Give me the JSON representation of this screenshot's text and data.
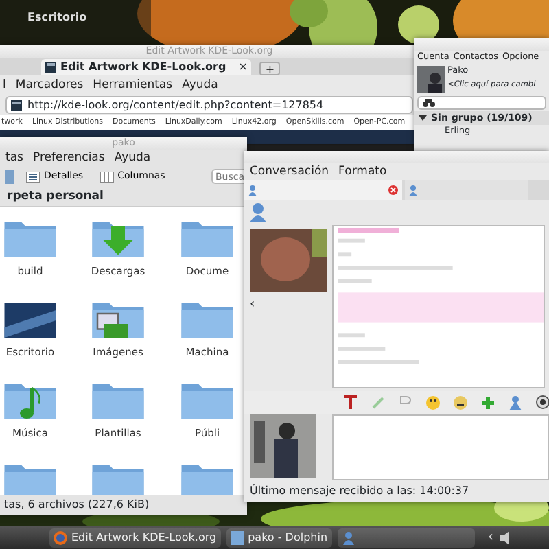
{
  "desktop": {
    "widget_title": "Escritorio"
  },
  "browser": {
    "title": "Edit Artwork KDE-Look.org",
    "tabs": [
      {
        "label": "Edit Artwork KDE-Look.org",
        "close": "×",
        "selected": true
      }
    ],
    "new_tab": "+",
    "menu": [
      "l",
      "Marcadores",
      "Herramientas",
      "Ayuda"
    ],
    "url": "http://kde-look.org/content/edit.php?content=127854",
    "bookmarks": [
      "twork",
      "Linux Distributions",
      "Documents",
      "LinuxDaily.com",
      "Linux42.org",
      "OpenSkills.com",
      "Open-PC.com"
    ]
  },
  "contact_list": {
    "menu": [
      "Cuenta",
      "Contactos",
      "Opcione"
    ],
    "name": "Pako",
    "status_message": "<Clic aquí para cambi",
    "group": {
      "label": "Sin grupo (19/109)",
      "expanded": true
    },
    "contacts": [
      "Erling"
    ]
  },
  "file_manager": {
    "title": "pako",
    "menu": [
      "tas",
      "Preferencias",
      "Ayuda"
    ],
    "view_buttons": [
      "Detalles",
      "Columnas"
    ],
    "search": {
      "placeholder": "Busca"
    },
    "location": "rpeta personal",
    "items": [
      {
        "label": "build",
        "kind": "folder"
      },
      {
        "label": "Descargas",
        "kind": "download"
      },
      {
        "label": "Docume",
        "kind": "folder"
      },
      {
        "label": "Escritorio",
        "kind": "desktop"
      },
      {
        "label": "Imágenes",
        "kind": "pictures"
      },
      {
        "label": "Machina",
        "kind": "folder"
      },
      {
        "label": "Música",
        "kind": "music"
      },
      {
        "label": "Plantillas",
        "kind": "folder"
      },
      {
        "label": "Públi",
        "kind": "folder"
      },
      {
        "kind": "folder"
      },
      {
        "kind": "folder"
      },
      {
        "kind": "folder"
      }
    ],
    "status": "tas, 6 archivos (227,6 KiB)"
  },
  "chat": {
    "menu": [
      "Conversación",
      "Formato"
    ],
    "tabs": [
      {
        "selected": true,
        "closable": true
      },
      {
        "selected": false,
        "closable": false
      }
    ],
    "collapse": "‹",
    "status": "Último mensaje recibido a las: 14:00:37"
  },
  "taskbar": {
    "tasks": [
      {
        "label": "Edit Artwork KDE-Look.org",
        "kind": "browser"
      },
      {
        "label": "pako - Dolphin",
        "kind": "files"
      },
      {
        "kind": "chat"
      }
    ],
    "pager": "‹"
  }
}
